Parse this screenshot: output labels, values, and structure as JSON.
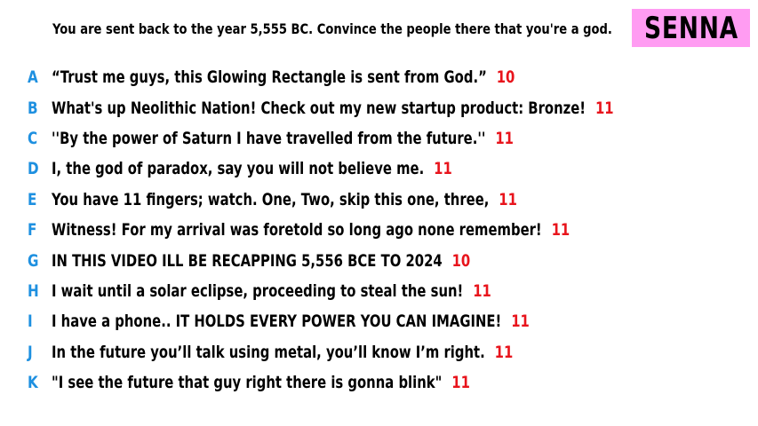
{
  "prompt": "You are sent back to the year 5,555 BC. Convince the people there that you're a god.",
  "name": "SENNA",
  "colors": {
    "badge_bg": "#ff9cf2",
    "letter": "#1e90e0",
    "score": "#e8141c",
    "text": "#000000"
  },
  "answers": [
    {
      "letter": "A",
      "text": "“Trust me guys, this Glowing Rectangle is sent from God.”",
      "score": "10"
    },
    {
      "letter": "B",
      "text": "What's up Neolithic Nation! Check out my new startup product: Bronze!",
      "score": "11"
    },
    {
      "letter": "C",
      "text": "''By the power of Saturn I have travelled from the future.''",
      "score": "11"
    },
    {
      "letter": "D",
      "text": "I, the god of paradox, say you will not believe me.",
      "score": "11"
    },
    {
      "letter": "E",
      "text": "You have 11 fingers; watch. One, Two, skip this one, three,",
      "score": "11"
    },
    {
      "letter": "F",
      "text": "Witness! For my arrival was foretold so long ago none remember!",
      "score": "11"
    },
    {
      "letter": "G",
      "text": "IN THIS VIDEO ILL BE RECAPPING 5,556 BCE TO 2024",
      "score": "10"
    },
    {
      "letter": "H",
      "text": "I wait until a solar eclipse, proceeding to steal the sun!",
      "score": "11"
    },
    {
      "letter": "I",
      "text": "I have a phone.. IT HOLDS EVERY POWER YOU CAN IMAGINE!",
      "score": "11"
    },
    {
      "letter": "J",
      "text": "In the future you’ll talk using metal, you’ll know I’m right.",
      "score": "11"
    },
    {
      "letter": "K",
      "text": "\"I see the future that guy right there is gonna blink\"",
      "score": "11"
    }
  ]
}
